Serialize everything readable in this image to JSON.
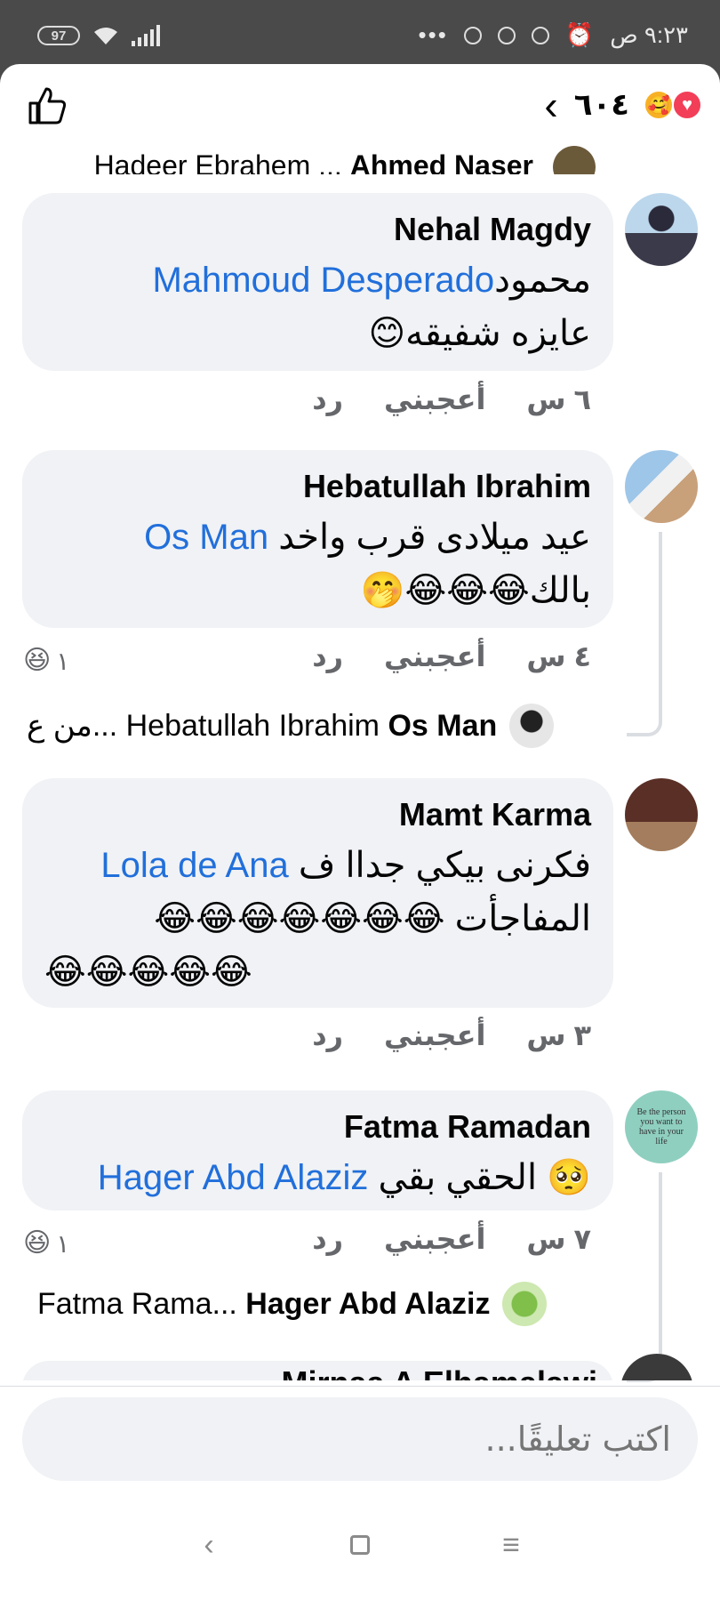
{
  "status_bar": {
    "battery": "97",
    "time": "٩:٢٣ ص"
  },
  "header": {
    "reaction_count": "٦٠٤",
    "icons": [
      "like-icon",
      "back-chevron-icon",
      "care-reaction-icon",
      "love-reaction-icon"
    ]
  },
  "partial_top": {
    "author": "Ahmed Naser",
    "text": "Hadeer Ebrahem ..."
  },
  "comments": [
    {
      "author": "Nehal Magdy",
      "line1_text": "محمود",
      "line1_mention": "Mahmoud Desperado",
      "line2_text": "عايزه شفيقه",
      "line2_emoji": "😊",
      "time": "٦ س",
      "like": "أعجبني",
      "reply": "رد"
    },
    {
      "author": "Hebatullah Ibrahim",
      "line1_text": "عيد ميلادى قرب واخد",
      "line1_mention": "Os Man",
      "line2_text": "بالك",
      "line2_emoji": "😂😂😂🤭",
      "time": "٤ س",
      "like": "أعجبني",
      "reply": "رد",
      "reaction_count": "١",
      "reaction_emoji": "😆",
      "reply_preview": {
        "author": "Os Man",
        "text": "من ع... Hebatullah Ibrahim"
      }
    },
    {
      "author": "Mamt Karma",
      "line1_text": "فكرنى بيكي جداا ف",
      "line1_mention": "Lola de Ana",
      "line2_text": "المفاجأت",
      "line2_emoji": "😂😂😂😂😂😂😂",
      "line3_emoji": "😂😂😂😂😂",
      "time": "٣ س",
      "like": "أعجبني",
      "reply": "رد"
    },
    {
      "author": "Fatma Ramadan",
      "line1_text": "الحقي بقي",
      "line1_mention": "Hager Abd Alaziz",
      "line1_emoji": "🥺",
      "time": "٧ س",
      "like": "أعجبني",
      "reply": "رد",
      "reaction_count": "١",
      "reaction_emoji": "😆",
      "reply_preview": {
        "author": "Hager Abd Alaziz",
        "text": "Fatma Rama..."
      }
    }
  ],
  "partial_bottom": {
    "author": "Mirnaa A Elhamalawi"
  },
  "input": {
    "placeholder": "اكتب تعليقًا..."
  },
  "avatar_4_text": "Be the person you want to have in your life",
  "colors": {
    "mention": "#216fdb",
    "bubble": "#f0f2f5",
    "meta": "#65676b",
    "status_bar": "#4a4a4a"
  }
}
